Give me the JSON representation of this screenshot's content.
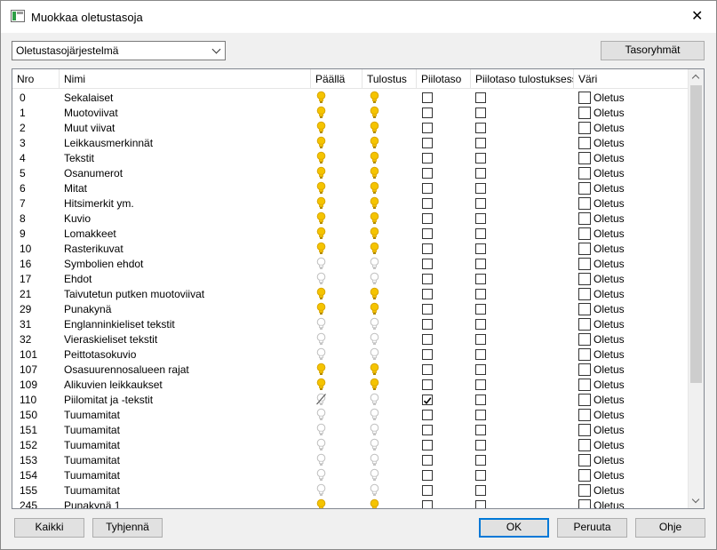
{
  "window": {
    "title": "Muokkaa oletustasoja",
    "close_glyph": "✕"
  },
  "toolbar": {
    "layer_system": "Oletustasojärjestelmä",
    "layer_groups_label": "Tasoryhmät"
  },
  "table": {
    "columns": [
      "Nro",
      "Nimi",
      "Päällä",
      "Tulostus",
      "Piilotaso",
      "Piilotaso tulostuksessa",
      "Väri"
    ],
    "color_default": "Oletus",
    "rows": [
      {
        "nr": "0",
        "name": "Sekalaiset",
        "on": "yellow",
        "print": "yellow",
        "hidden": false
      },
      {
        "nr": "1",
        "name": "Muotoviivat",
        "on": "yellow",
        "print": "yellow",
        "hidden": false
      },
      {
        "nr": "2",
        "name": "Muut viivat",
        "on": "yellow",
        "print": "yellow",
        "hidden": false
      },
      {
        "nr": "3",
        "name": "Leikkausmerkinnät",
        "on": "yellow",
        "print": "yellow",
        "hidden": false
      },
      {
        "nr": "4",
        "name": "Tekstit",
        "on": "yellow",
        "print": "yellow",
        "hidden": false
      },
      {
        "nr": "5",
        "name": "Osanumerot",
        "on": "yellow",
        "print": "yellow",
        "hidden": false
      },
      {
        "nr": "6",
        "name": "Mitat",
        "on": "yellow",
        "print": "yellow",
        "hidden": false
      },
      {
        "nr": "7",
        "name": "Hitsimerkit ym.",
        "on": "yellow",
        "print": "yellow",
        "hidden": false
      },
      {
        "nr": "8",
        "name": "Kuvio",
        "on": "yellow",
        "print": "yellow",
        "hidden": false
      },
      {
        "nr": "9",
        "name": "Lomakkeet",
        "on": "yellow",
        "print": "yellow",
        "hidden": false
      },
      {
        "nr": "10",
        "name": "Rasterikuvat",
        "on": "yellow",
        "print": "yellow",
        "hidden": false
      },
      {
        "nr": "16",
        "name": "Symbolien ehdot",
        "on": "grey",
        "print": "grey",
        "hidden": false
      },
      {
        "nr": "17",
        "name": "Ehdot",
        "on": "grey",
        "print": "grey",
        "hidden": false
      },
      {
        "nr": "21",
        "name": "Taivutetun putken muotoviivat",
        "on": "yellow",
        "print": "yellow",
        "hidden": false
      },
      {
        "nr": "29",
        "name": "Punakynä",
        "on": "yellow",
        "print": "yellow",
        "hidden": false
      },
      {
        "nr": "31",
        "name": "Englanninkieliset tekstit",
        "on": "grey",
        "print": "grey",
        "hidden": false
      },
      {
        "nr": "32",
        "name": "Vieraskieliset tekstit",
        "on": "grey",
        "print": "grey",
        "hidden": false
      },
      {
        "nr": "101",
        "name": "Peittotasokuvio",
        "on": "grey",
        "print": "grey",
        "hidden": false
      },
      {
        "nr": "107",
        "name": "Osasuurennosalueen rajat",
        "on": "yellow",
        "print": "yellow",
        "hidden": false
      },
      {
        "nr": "109",
        "name": "Alikuvien leikkaukset",
        "on": "yellow",
        "print": "yellow",
        "hidden": false
      },
      {
        "nr": "110",
        "name": "Piilomitat ja -tekstit",
        "on": "struck",
        "print": "grey",
        "hidden": true
      },
      {
        "nr": "150",
        "name": "Tuumamitat",
        "on": "grey",
        "print": "grey",
        "hidden": false
      },
      {
        "nr": "151",
        "name": "Tuumamitat",
        "on": "grey",
        "print": "grey",
        "hidden": false
      },
      {
        "nr": "152",
        "name": "Tuumamitat",
        "on": "grey",
        "print": "grey",
        "hidden": false
      },
      {
        "nr": "153",
        "name": "Tuumamitat",
        "on": "grey",
        "print": "grey",
        "hidden": false
      },
      {
        "nr": "154",
        "name": "Tuumamitat",
        "on": "grey",
        "print": "grey",
        "hidden": false
      },
      {
        "nr": "155",
        "name": "Tuumamitat",
        "on": "grey",
        "print": "grey",
        "hidden": false
      },
      {
        "nr": "245",
        "name": "Punakynä 1",
        "on": "yellow",
        "print": "yellow",
        "hidden": false
      }
    ]
  },
  "footer": {
    "all_label": "Kaikki",
    "clear_label": "Tyhjennä",
    "ok_label": "OK",
    "cancel_label": "Peruuta",
    "help_label": "Ohje"
  },
  "icons": {
    "bulb_on": "lightbulb-on-icon",
    "bulb_off": "lightbulb-off-icon",
    "bulb_struck": "lightbulb-disabled-icon",
    "chevron": "chevron-down-icon",
    "close": "close-icon"
  },
  "colors": {
    "bulb_on": "#f5c400",
    "bulb_off": "#d4d4d4",
    "accent": "#0078d7"
  }
}
